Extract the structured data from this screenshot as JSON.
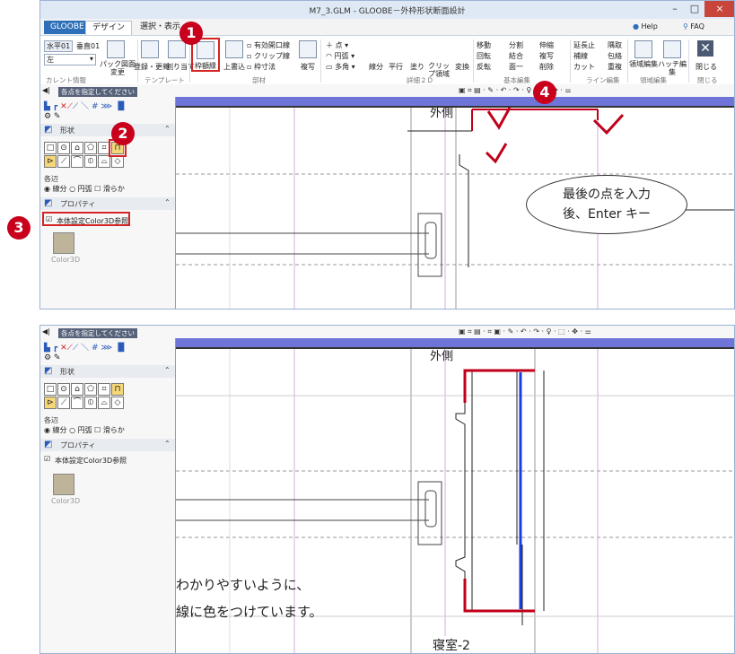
{
  "top_window": {
    "title": "M7_3.GLM - GLOOBE－外枠形状断面設計",
    "tabs": [
      "GLOOBE",
      "デザイン",
      "選択・表示"
    ],
    "help": "Help",
    "faq": "FAQ",
    "ribbon": {
      "current_info": {
        "level": "水平01",
        "vertical": "垂直01",
        "side": "左",
        "label": "カレント情報"
      },
      "template": {
        "buttons": [
          "パック図面変更",
          "登録・更新",
          "割り当て"
        ],
        "label": "テンプレート"
      },
      "parts": {
        "buttons": [
          "枠額縁",
          "上書込",
          "有効開口線",
          "クリップ線",
          "枠寸法",
          "複写"
        ],
        "label": "部材"
      },
      "detail2d": {
        "buttons": [
          "点",
          "円弧",
          "多角",
          "線分",
          "平行",
          "塗り",
          "クリップ領域",
          "変換"
        ],
        "label": "詳細２Ｄ"
      },
      "basic_edit": {
        "buttons": [
          "移動",
          "分割",
          "伸縮",
          "回転",
          "結合",
          "複写",
          "反転",
          "面一",
          "削除"
        ],
        "label": "基本編集"
      },
      "line_edit": {
        "buttons": [
          "延長止",
          "隅取",
          "補線",
          "包絡",
          "カット",
          "重複"
        ],
        "label": "ライン編集"
      },
      "area_edit": {
        "buttons": [
          "領域編集",
          "ハッチ編集"
        ],
        "label": "領域編集"
      },
      "close": {
        "button": "閉じる",
        "label": "閉じる"
      }
    },
    "status_prompt": "各点を指定してください",
    "canvas_label": "外側",
    "callout": {
      "line1": "最後の点を入力",
      "line2": "後、Enter キー"
    }
  },
  "bottom_window": {
    "status_prompt": "各点を指定してください",
    "canvas_label": "外側",
    "room_label": "寝室-2",
    "note": {
      "mark": "※",
      "line1": "わかりやすいように、",
      "line2": "線に色をつけています。"
    }
  },
  "panel": {
    "shape_title": "形状",
    "edge_title": "各辺",
    "edge_options": [
      "線分",
      "円弧",
      "滑らか"
    ],
    "property_title": "プロパティ",
    "checkbox_label": "本体設定Color3D参照",
    "swatch_label": "Color3D",
    "colors": {
      "swatch": "#bdb49a"
    }
  },
  "steps": [
    "1",
    "2",
    "3",
    "4"
  ],
  "colors": {
    "accent": "#c8001c",
    "frame_line": "#c0001a",
    "blue_line": "#1a3fd6",
    "canvas_bar": "#6f74d8"
  }
}
